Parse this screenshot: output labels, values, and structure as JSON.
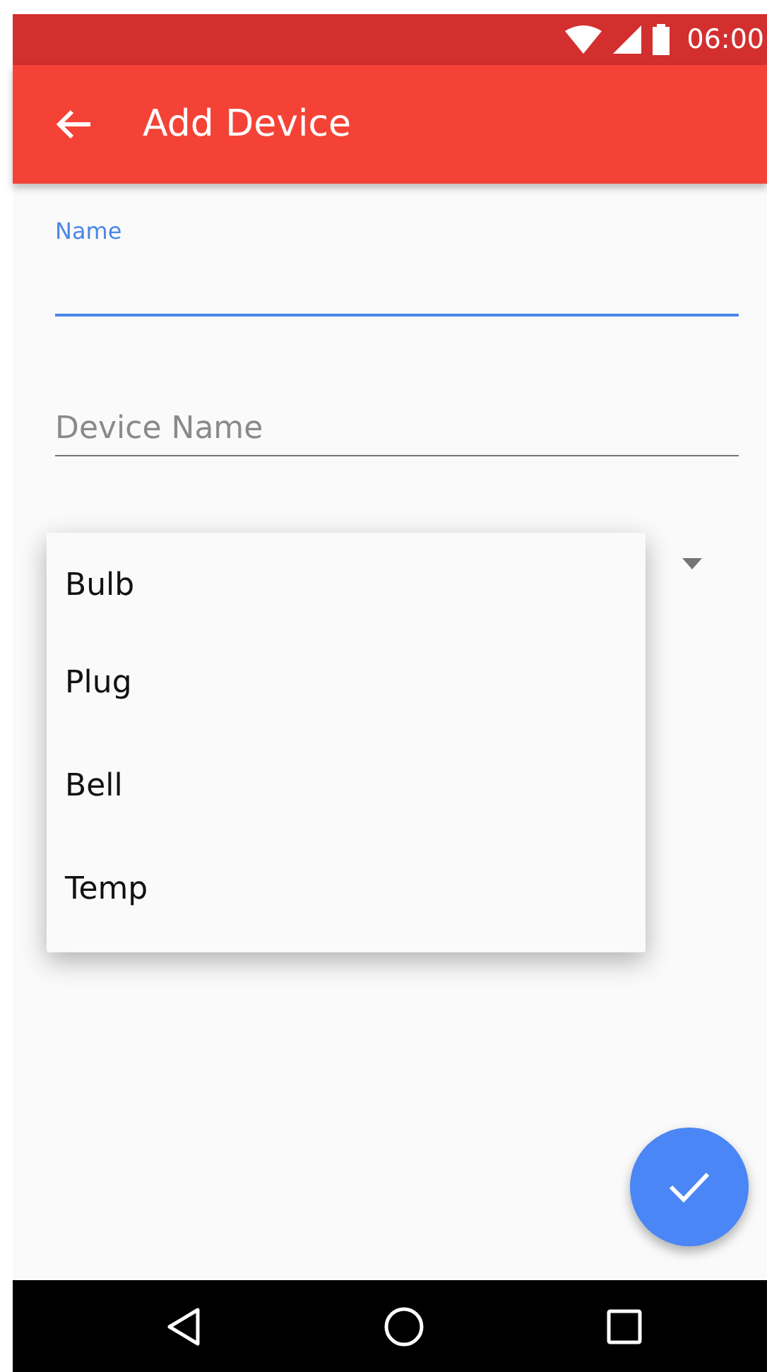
{
  "status_bar": {
    "time": "06:00"
  },
  "app_bar": {
    "title": "Add Device"
  },
  "fields": [
    {
      "label": "Name",
      "focused": true
    },
    {
      "placeholder": "Device Name",
      "focused": false
    }
  ],
  "dropdown": {
    "expanded": true,
    "options": [
      {
        "label": "Bulb"
      },
      {
        "label": "Plug"
      },
      {
        "label": "Bell"
      },
      {
        "label": "Temp"
      }
    ]
  }
}
